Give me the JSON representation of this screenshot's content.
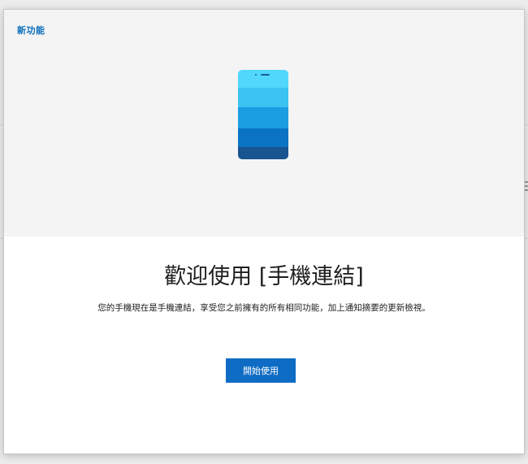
{
  "dialog": {
    "header_label": "新功能",
    "title": "歡迎使用 [手機連結]",
    "subtitle": "您的手機現在是手機連結，享受您之前擁有的所有相同功能，加上通知摘要的更新檢視。",
    "start_button_label": "開始使用"
  },
  "illustration": {
    "icon": "smartphone-icon",
    "band_colors": [
      "#50d7fb",
      "#3ac3f2",
      "#1b9de2",
      "#0a73c4",
      "#18548f"
    ]
  },
  "colors": {
    "accent": "#0f6cc4",
    "header_label": "#0a6fbd",
    "hero_background": "#f4f4f4"
  }
}
